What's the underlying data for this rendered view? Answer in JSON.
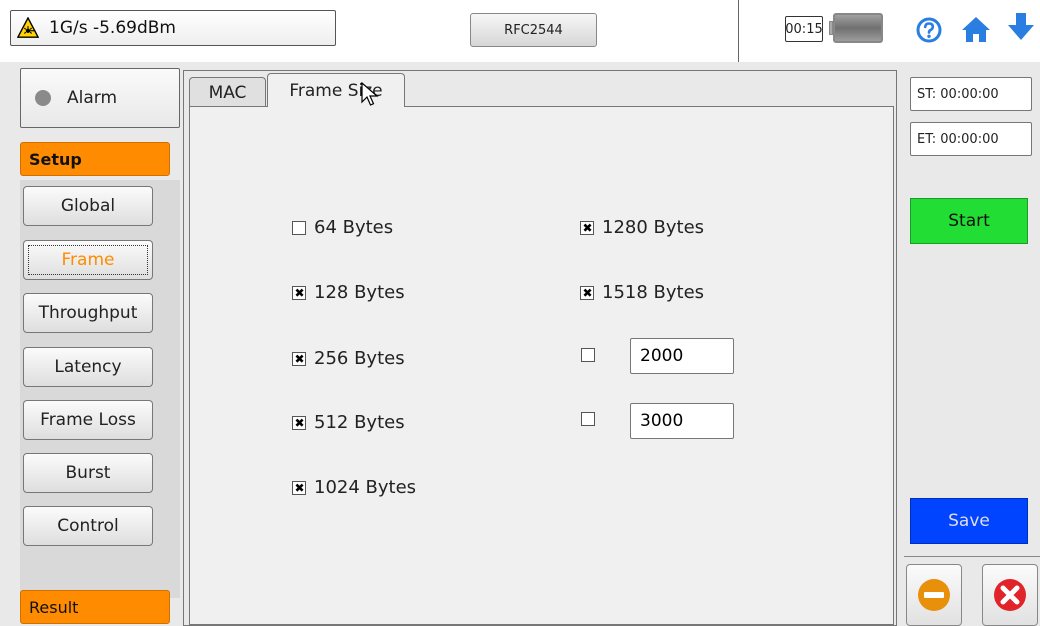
{
  "status": {
    "signal_text": "1G/s -5.69dBm",
    "test_name": "RFC2544",
    "timer": "00:15"
  },
  "left": {
    "alarm_label": "Alarm",
    "setup_label": "Setup",
    "nav": [
      "Global",
      "Frame",
      "Throughput",
      "Latency",
      "Frame Loss",
      "Burst",
      "Control"
    ],
    "active_nav": "Frame",
    "result_label": "Result"
  },
  "tabs": {
    "mac": "MAC",
    "frame_size": "Frame Size",
    "active": "Frame Size"
  },
  "frame_sizes": {
    "left": [
      {
        "label": "64 Bytes",
        "checked": false
      },
      {
        "label": "128 Bytes",
        "checked": true
      },
      {
        "label": "256 Bytes",
        "checked": true
      },
      {
        "label": "512 Bytes",
        "checked": true
      },
      {
        "label": "1024 Bytes",
        "checked": true
      }
    ],
    "right": [
      {
        "label": "1280 Bytes",
        "checked": true
      },
      {
        "label": "1518 Bytes",
        "checked": true
      }
    ],
    "custom": [
      {
        "value": "2000",
        "checked": false
      },
      {
        "value": "3000",
        "checked": false
      }
    ]
  },
  "right": {
    "st_text": "ST: 00:00:00",
    "et_text": "ET: 00:00:00",
    "start_label": "Start",
    "save_label": "Save"
  },
  "colors": {
    "accent": "#ff8c00",
    "start": "#22dd33",
    "save": "#0044ff",
    "help": "#2a7de1",
    "home": "#2a7de1",
    "minus": "#e8900a",
    "close": "#e0242a"
  },
  "icons": [
    "laser-warning-icon",
    "battery-icon",
    "help-icon",
    "home-icon",
    "download-arrow-icon",
    "minimize-icon",
    "close-icon"
  ]
}
